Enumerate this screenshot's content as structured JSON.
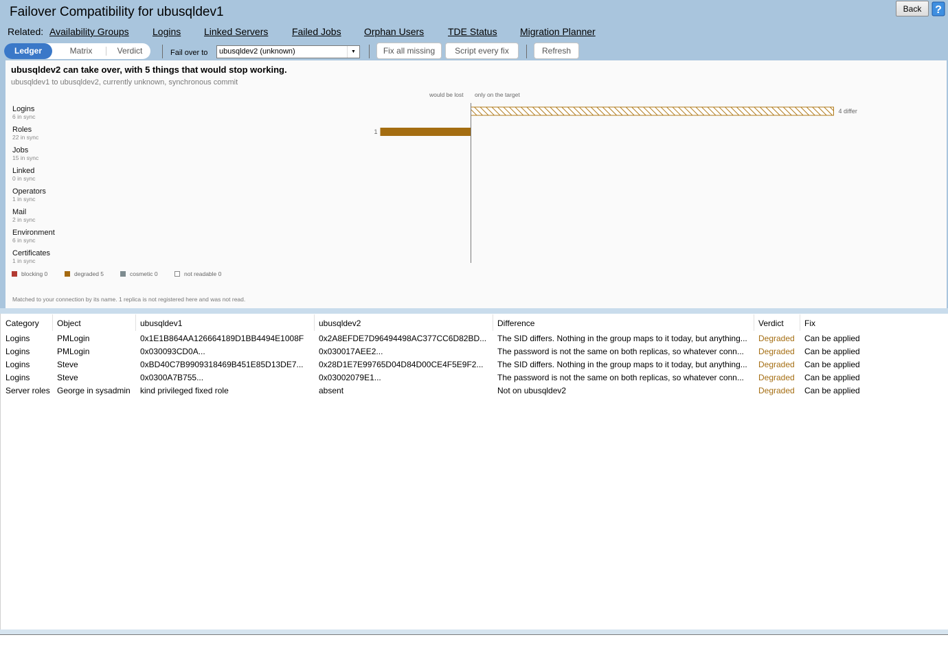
{
  "window": {
    "title": "Failover Compatibility for ubusqldev1"
  },
  "toolbar": {
    "back_label": "Back",
    "related_label": "Related:",
    "related_links": [
      "Availability Groups",
      "Logins",
      "Linked Servers",
      "Failed Jobs",
      "Orphan Users",
      "TDE Status",
      "Migration Planner"
    ],
    "views": [
      "Ledger",
      "Matrix",
      "Verdict"
    ],
    "active_view": "Ledger",
    "failover_label": "Fail over to",
    "failover_value": "ubusqldev2  (unknown)",
    "fix_all_label": "Fix all missing",
    "script_fix_label": "Script every fix",
    "refresh_label": "Refresh"
  },
  "summary": {
    "headline": "ubusqldev2 can take over, with 5 things that would stop working.",
    "subline": "ubusqldev1 to ubusqldev2, currently unknown, synchronous commit",
    "axis_left_label": "would be lost",
    "axis_right_label": "only on the target",
    "footnote": "Matched to your connection by its name. 1 replica is not registered here and was not read."
  },
  "chart_data": {
    "type": "bar",
    "orientation": "diverging-horizontal",
    "categories": [
      {
        "name": "Logins",
        "sync": "6 in sync",
        "lost": 0,
        "target_only": 4,
        "target_label": "4 differ",
        "lost_label": ""
      },
      {
        "name": "Roles",
        "sync": "22 in sync",
        "lost": 1,
        "target_only": 0,
        "target_label": "",
        "lost_label": "1"
      },
      {
        "name": "Jobs",
        "sync": "15 in sync",
        "lost": 0,
        "target_only": 0,
        "target_label": "",
        "lost_label": ""
      },
      {
        "name": "Linked",
        "sync": "0 in sync",
        "lost": 0,
        "target_only": 0,
        "target_label": "",
        "lost_label": ""
      },
      {
        "name": "Operators",
        "sync": "1 in sync",
        "lost": 0,
        "target_only": 0,
        "target_label": "",
        "lost_label": ""
      },
      {
        "name": "Mail",
        "sync": "2 in sync",
        "lost": 0,
        "target_only": 0,
        "target_label": "",
        "lost_label": ""
      },
      {
        "name": "Environment",
        "sync": "6 in sync",
        "lost": 0,
        "target_only": 0,
        "target_label": "",
        "lost_label": ""
      },
      {
        "name": "Certificates",
        "sync": "1 in sync",
        "lost": 0,
        "target_only": 0,
        "target_label": "",
        "lost_label": ""
      }
    ],
    "legend": [
      {
        "label": "blocking 0",
        "color": "#b23a32"
      },
      {
        "label": "degraded 5",
        "color": "#a4690f"
      },
      {
        "label": "cosmetic 0",
        "color": "#7e8c90"
      },
      {
        "label": "not readable 0",
        "color": "#ffffff"
      }
    ],
    "colors": {
      "lost_bar": "#a46d11",
      "hatch": "#b07a1a"
    }
  },
  "table": {
    "columns": [
      "Category",
      "Object",
      "ubusqldev1",
      "ubusqldev2",
      "Difference",
      "Verdict",
      "Fix"
    ],
    "rows": [
      [
        "Logins",
        "PMLogin",
        "0x1E1B864AA126664189D1BB4494E1008F",
        "0x2A8EFDE7D96494498AC377CC6D82BD...",
        "The SID differs. Nothing in the group maps to it today, but anything...",
        "Degraded",
        "Can be applied"
      ],
      [
        "Logins",
        "PMLogin",
        "0x030093CD0A...",
        "0x030017AEE2...",
        "The password is not the same on both replicas, so whatever conn...",
        "Degraded",
        "Can be applied"
      ],
      [
        "Logins",
        "Steve",
        "0xBD40C7B9909318469B451E85D13DE7...",
        "0x28D1E7E99765D04D84D00CE4F5E9F2...",
        "The SID differs. Nothing in the group maps to it today, but anything...",
        "Degraded",
        "Can be applied"
      ],
      [
        "Logins",
        "Steve",
        "0x0300A7B755...",
        "0x03002079E1...",
        "The password is not the same on both replicas, so whatever conn...",
        "Degraded",
        "Can be applied"
      ],
      [
        "Server roles",
        "George in sysadmin",
        "kind privileged fixed role",
        "absent",
        "Not on ubusqldev2",
        "Degraded",
        "Can be applied"
      ]
    ]
  }
}
